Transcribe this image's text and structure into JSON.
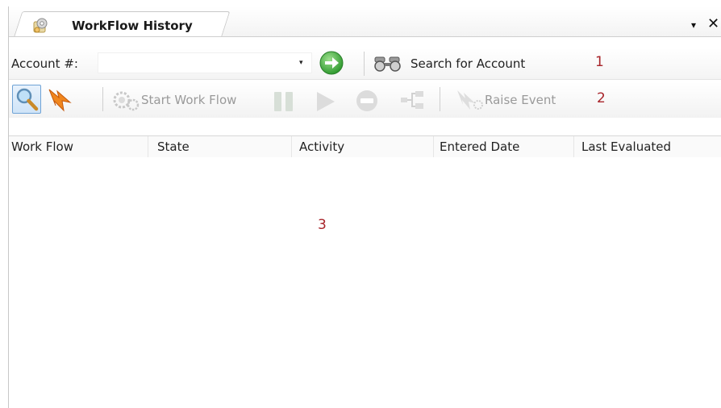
{
  "tab": {
    "title": "WorkFlow History",
    "icon": "gear-scroll-icon",
    "dropdown_glyph": "▾",
    "close_glyph": "✕"
  },
  "search_bar": {
    "account_label": "Account #:",
    "account_value": "",
    "dropdown_glyph": "▾",
    "go_icon": "green-arrow-right-icon",
    "search_label": "Search for Account",
    "search_icon": "binoculars-icon",
    "annotation": "1"
  },
  "toolbar": {
    "search_icon": "magnifier-icon",
    "event_icon": "orange-lightning-icon",
    "start_workflow_label": "Start Work Flow",
    "raise_event_label": "Raise Event",
    "annotation": "2"
  },
  "grid": {
    "columns": [
      "Work Flow",
      "State",
      "Activity",
      "Entered Date",
      "Last Evaluated"
    ],
    "rows": [],
    "annotation": "3"
  },
  "colors": {
    "annotation": "#a8242a",
    "go_green": "#3ca83c",
    "selected_blue": "#6fa3d6",
    "disabled_gray": "#9a9a9a"
  }
}
